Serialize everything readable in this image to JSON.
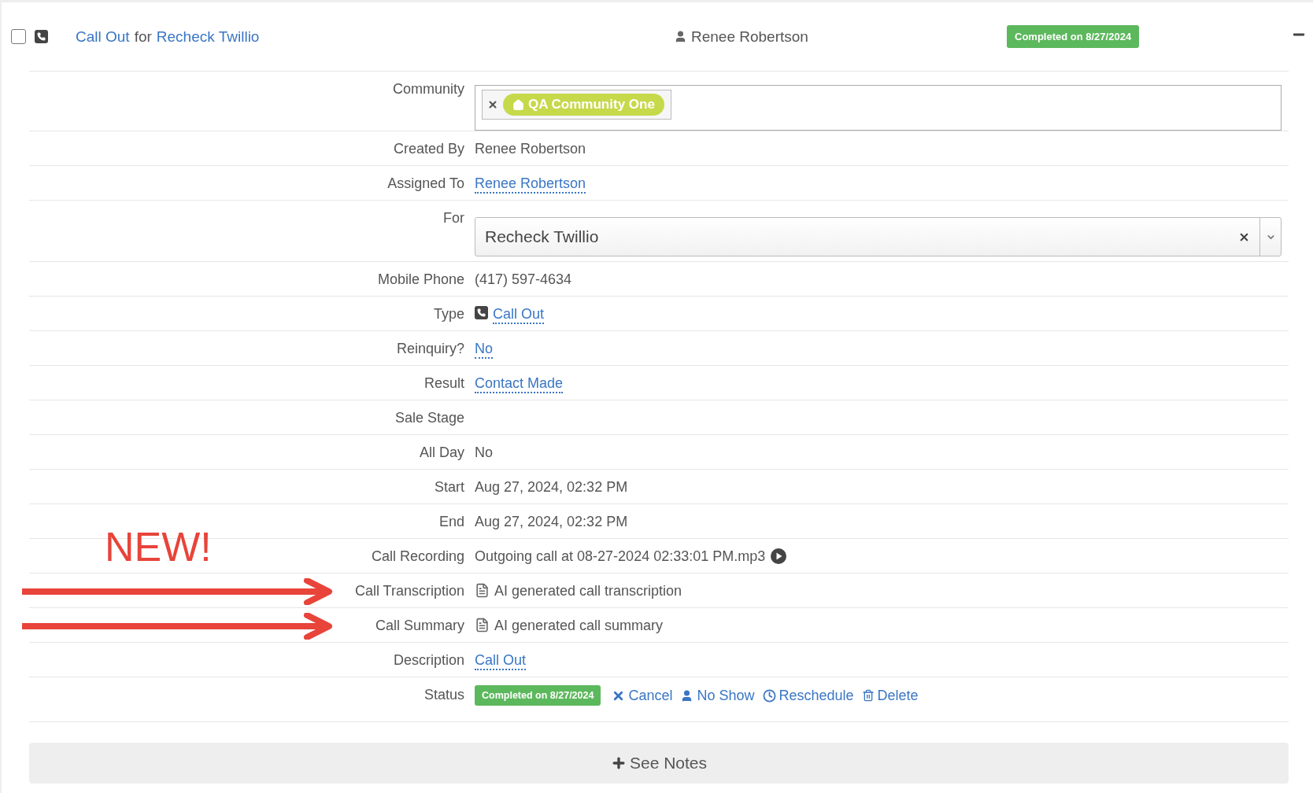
{
  "header": {
    "checked": false,
    "title_link": "Call Out",
    "title_joiner": "for",
    "title_target": "Recheck Twillio",
    "owner": "Renee Robertson",
    "status_badge": "Completed on 8/27/2024"
  },
  "annotation": {
    "label": "NEW!"
  },
  "fields": [
    {
      "kind": "tags",
      "label": "Community",
      "flagged": false,
      "tags": [
        {
          "label": "QA Community One"
        }
      ]
    },
    {
      "kind": "text",
      "label": "Created By",
      "flagged": false,
      "value": "Renee Robertson"
    },
    {
      "kind": "link",
      "label": "Assigned To",
      "flagged": false,
      "value": "Renee Robertson"
    },
    {
      "kind": "select",
      "label": "For",
      "flagged": false,
      "value": "Recheck Twillio"
    },
    {
      "kind": "text",
      "label": "Mobile Phone",
      "flagged": false,
      "value": "(417) 597-4634"
    },
    {
      "kind": "icon_link",
      "label": "Type",
      "flagged": false,
      "value": "Call Out"
    },
    {
      "kind": "link",
      "label": "Reinquiry?",
      "flagged": false,
      "value": "No"
    },
    {
      "kind": "link",
      "label": "Result",
      "flagged": false,
      "value": "Contact Made"
    },
    {
      "kind": "text",
      "label": "Sale Stage",
      "flagged": false
    },
    {
      "kind": "text",
      "label": "All Day",
      "flagged": false,
      "value": "No"
    },
    {
      "kind": "text",
      "label": "Start",
      "flagged": false,
      "value": "Aug 27, 2024, 02:32 PM"
    },
    {
      "kind": "text",
      "label": "End",
      "flagged": false,
      "value": "Aug 27, 2024, 02:32 PM"
    },
    {
      "kind": "audio",
      "label": "Call Recording",
      "flagged": false,
      "value": "Outgoing call at 08-27-2024 02:33:01 PM.mp3"
    },
    {
      "kind": "document",
      "label": "Call Transcription",
      "flagged": true,
      "value": "AI generated call transcription"
    },
    {
      "kind": "document",
      "label": "Call Summary",
      "flagged": true,
      "value": "AI generated call summary"
    },
    {
      "kind": "link",
      "label": "Description",
      "flagged": false,
      "value": "Call Out"
    },
    {
      "kind": "status",
      "label": "Status",
      "flagged": false,
      "badge": "Completed on 8/27/2024",
      "actions": [
        {
          "kind": "cancel",
          "label": "Cancel"
        },
        {
          "kind": "no_show",
          "label": "No Show"
        },
        {
          "kind": "reschedule",
          "label": "Reschedule"
        },
        {
          "kind": "delete",
          "label": "Delete"
        }
      ]
    }
  ],
  "notes_button": {
    "label": "See Notes"
  }
}
